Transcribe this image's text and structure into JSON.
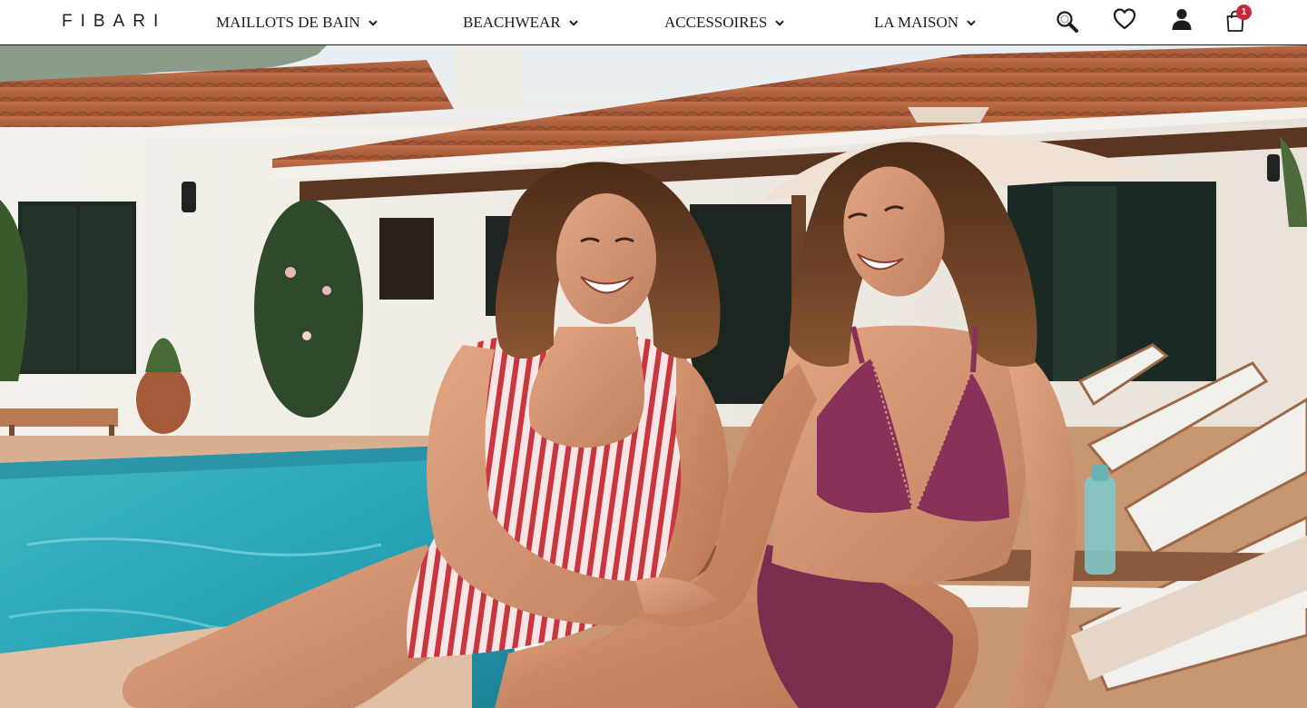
{
  "brand": {
    "logo_text": "FIBARI"
  },
  "nav": {
    "items": [
      {
        "label": "MAILLOTS DE BAIN"
      },
      {
        "label": "BEACHWEAR"
      },
      {
        "label": "ACCESSOIRES"
      },
      {
        "label": "LA MAISON"
      }
    ]
  },
  "header_icons": {
    "search": "search-icon",
    "wishlist": "heart-icon",
    "account": "user-icon",
    "cart": "shopping-bag-icon",
    "cart_count": "1"
  },
  "colors": {
    "text": "#1d1d1d",
    "badge": "#c8283c",
    "header_bg": "#ffffff"
  }
}
